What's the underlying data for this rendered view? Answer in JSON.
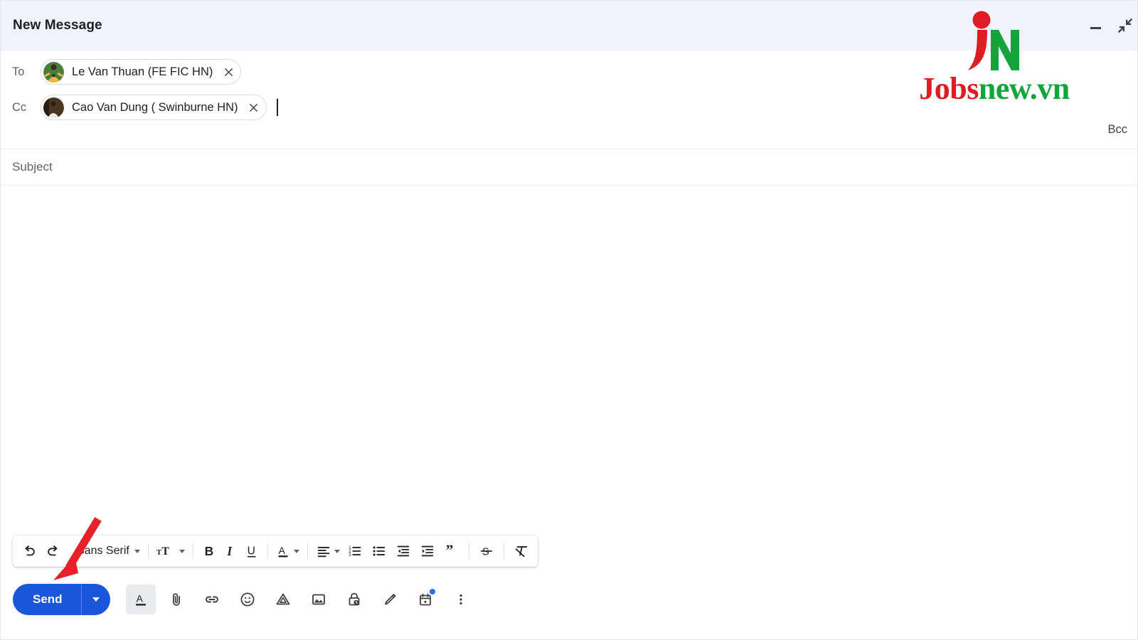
{
  "window": {
    "title": "New Message",
    "minimize_label": "Minimize",
    "fullscreen_label": "Exit full screen"
  },
  "recipients": {
    "to": {
      "label": "To",
      "chips": [
        {
          "name": "Le Van Thuan (FE FIC HN)",
          "remove_label": "Remove",
          "avatar_kind": "photo-yellow-shirt"
        }
      ]
    },
    "cc": {
      "label": "Cc",
      "chips": [
        {
          "name": "Cao Van Dung ( Swinburne HN)",
          "remove_label": "Remove",
          "avatar_kind": "photo-white-shirt"
        }
      ]
    },
    "bcc_label": "Bcc"
  },
  "subject": {
    "placeholder": "Subject",
    "value": ""
  },
  "body": {
    "value": ""
  },
  "format_toolbar": {
    "items": [
      {
        "name": "undo",
        "icon": "undo-icon",
        "label": "Undo"
      },
      {
        "name": "redo",
        "icon": "redo-icon",
        "label": "Redo"
      },
      {
        "name": "font-family",
        "icon": "font-family-dropdown",
        "label": "Sans Serif"
      },
      {
        "name": "font-size",
        "icon": "font-size-icon",
        "label": "Size"
      },
      {
        "name": "bold",
        "icon": "bold-icon",
        "label": "B"
      },
      {
        "name": "italic",
        "icon": "italic-icon",
        "label": "I"
      },
      {
        "name": "underline",
        "icon": "underline-icon",
        "label": "U"
      },
      {
        "name": "text-color",
        "icon": "text-color-icon",
        "label": "A"
      },
      {
        "name": "align",
        "icon": "align-left-icon",
        "label": "Align"
      },
      {
        "name": "numbered-list",
        "icon": "numbered-list-icon",
        "label": "Numbered list"
      },
      {
        "name": "bulleted-list",
        "icon": "bulleted-list-icon",
        "label": "Bulleted list"
      },
      {
        "name": "indent-less",
        "icon": "indent-decrease-icon",
        "label": "Indent less"
      },
      {
        "name": "indent-more",
        "icon": "indent-increase-icon",
        "label": "Indent more"
      },
      {
        "name": "quote",
        "icon": "quote-icon",
        "label": "Quote"
      },
      {
        "name": "strikethrough",
        "icon": "strikethrough-icon",
        "label": "Strikethrough"
      },
      {
        "name": "remove-formatting",
        "icon": "remove-formatting-icon",
        "label": "Remove formatting"
      }
    ],
    "font_name": "Sans Serif"
  },
  "action_bar": {
    "send_label": "Send",
    "send_options_label": "More send options",
    "items": [
      {
        "name": "formatting-options",
        "icon": "format-text-icon",
        "label": "Formatting options",
        "active": true
      },
      {
        "name": "attach-file",
        "icon": "paperclip-icon",
        "label": "Attach files",
        "active": false
      },
      {
        "name": "insert-link",
        "icon": "link-icon",
        "label": "Insert link",
        "active": false
      },
      {
        "name": "insert-emoji",
        "icon": "emoji-icon",
        "label": "Insert emoji",
        "active": false
      },
      {
        "name": "insert-drive",
        "icon": "google-drive-icon",
        "label": "Insert files using Drive",
        "active": false
      },
      {
        "name": "insert-photo",
        "icon": "image-icon",
        "label": "Insert photo",
        "active": false
      },
      {
        "name": "confidential-mode",
        "icon": "lock-clock-icon",
        "label": "Toggle confidential mode",
        "active": false
      },
      {
        "name": "insert-signature",
        "icon": "pen-icon",
        "label": "Insert signature",
        "active": false
      },
      {
        "name": "schedule-send",
        "icon": "calendar-icon",
        "label": "Schedule send",
        "active": false,
        "badge": true
      },
      {
        "name": "more-options",
        "icon": "more-vertical-icon",
        "label": "More options",
        "active": false
      }
    ]
  },
  "watermark": {
    "monogram_j": "j",
    "monogram_n": "N",
    "word_first": "Jobs",
    "word_second": "new.vn",
    "color_red": "#e01b22",
    "color_green": "#13a43b"
  },
  "annotation": {
    "arrow_color": "#e8202a",
    "points_to": "send-button"
  }
}
